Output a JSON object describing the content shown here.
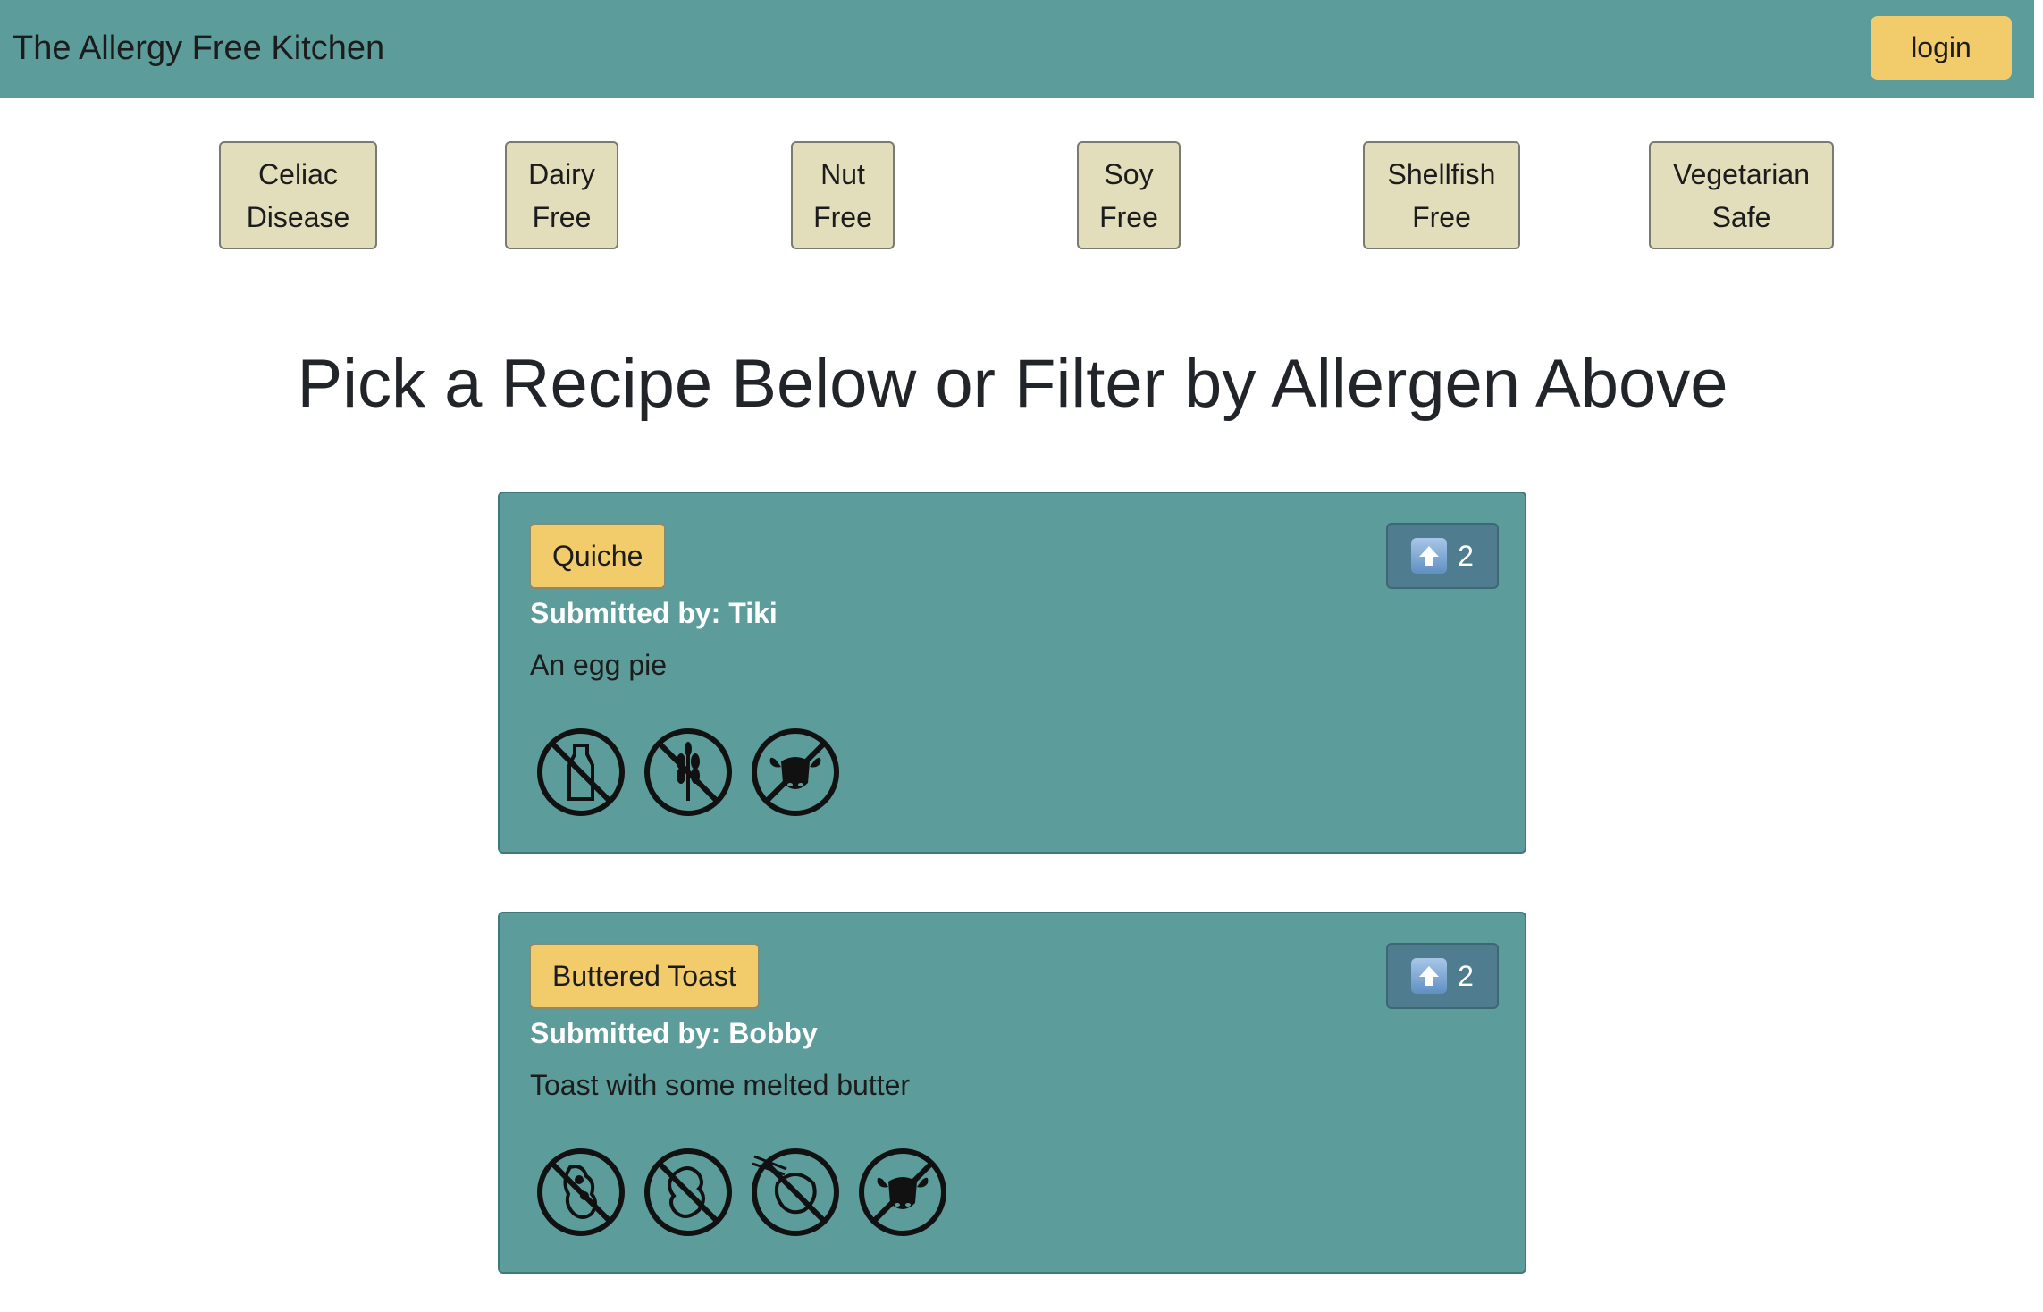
{
  "header": {
    "title": "The Allergy Free Kitchen",
    "login_label": "login"
  },
  "filters": [
    {
      "line1": "Celiac",
      "line2": "Disease"
    },
    {
      "line1": "Dairy",
      "line2": "Free"
    },
    {
      "line1": "Nut",
      "line2": "Free"
    },
    {
      "line1": "Soy",
      "line2": "Free"
    },
    {
      "line1": "Shellfish",
      "line2": "Free"
    },
    {
      "line1": "Vegetarian",
      "line2": "Safe"
    }
  ],
  "main": {
    "heading": "Pick a Recipe Below or Filter by Allergen Above"
  },
  "recipes": [
    {
      "name": "Quiche",
      "submitted_by": "Submitted by: Tiki",
      "description": "An egg pie",
      "votes": "2",
      "allergen_icons": [
        "no-dairy-icon",
        "no-gluten-icon",
        "no-meat-icon"
      ]
    },
    {
      "name": "Buttered Toast",
      "submitted_by": "Submitted by: Bobby",
      "description": "Toast with some melted butter",
      "votes": "2",
      "allergen_icons": [
        "no-soy-icon",
        "no-peanut-icon",
        "no-shellfish-icon",
        "no-meat-icon"
      ]
    }
  ],
  "colors": {
    "navbar": "#5c9c9a",
    "accent": "#f2cc6b",
    "filter_bg": "#e2debb",
    "vote_bg": "#4f7d8f"
  }
}
